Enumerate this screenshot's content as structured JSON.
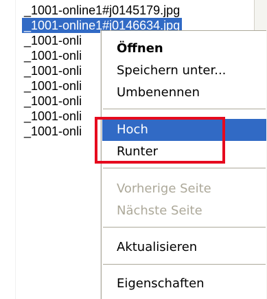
{
  "file_list": {
    "items": [
      "_1001-online1#j0145179.jpg",
      "_1001-onli",
      "_1001-onli",
      "_1001-onli",
      "_1001-onli",
      "_1001-onli",
      "_1001-onli",
      "_1001-onli"
    ],
    "selected_item": "_1001-online1#j0146634.jpg",
    "selected_color": "#316ac5"
  },
  "context_menu": {
    "items": [
      {
        "label": "Öffnen",
        "bold": true,
        "enabled": true
      },
      {
        "label": "Speichern unter...",
        "enabled": true
      },
      {
        "label": "Umbenennen",
        "enabled": true
      },
      {
        "label": "Hoch",
        "enabled": true,
        "highlighted": true
      },
      {
        "label": "Runter",
        "enabled": true
      },
      {
        "label": "Vorherige Seite",
        "enabled": false
      },
      {
        "label": "Nächste Seite",
        "enabled": false
      },
      {
        "label": "Aktualisieren",
        "enabled": true
      },
      {
        "label": "Eigenschaften",
        "enabled": true
      }
    ],
    "highlight_color": "#316ac5",
    "disabled_color": "#aca899"
  },
  "annotation": {
    "color": "#e60a1e"
  }
}
